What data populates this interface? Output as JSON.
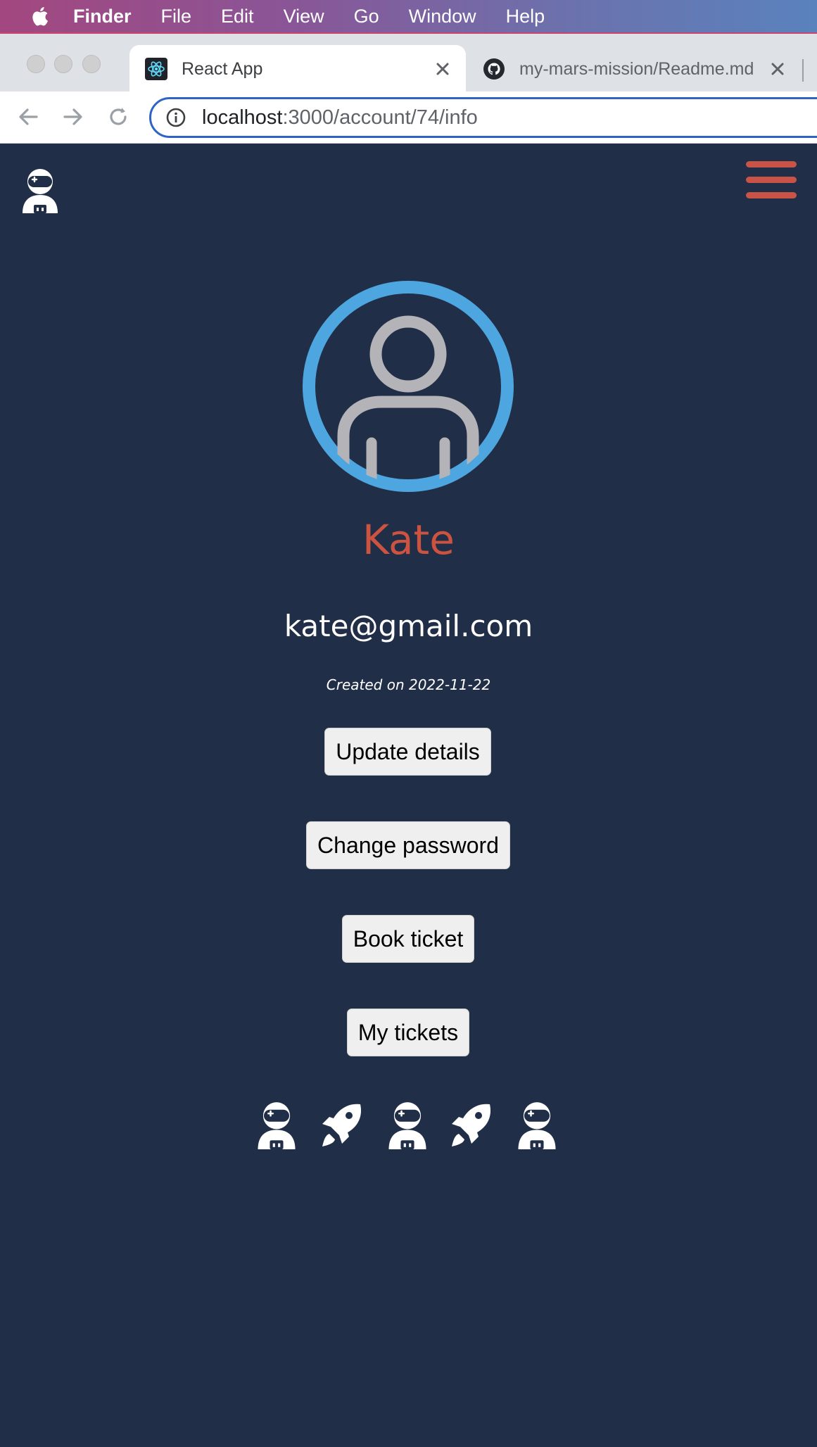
{
  "menubar": {
    "app_name": "Finder",
    "items": [
      "File",
      "Edit",
      "View",
      "Go",
      "Window",
      "Help"
    ]
  },
  "tabs": [
    {
      "title": "React App",
      "favicon": "react-icon",
      "active": true
    },
    {
      "title": "my-mars-mission/Readme.md",
      "favicon": "github-icon",
      "active": false
    }
  ],
  "address_bar": {
    "host": "localhost",
    "path": ":3000/account/74/info"
  },
  "profile": {
    "name": "Kate",
    "email": "kate@gmail.com",
    "created": "Created on 2022-11-22"
  },
  "buttons": {
    "update": "Update details",
    "password": "Change password",
    "book": "Book ticket",
    "tickets": "My tickets"
  },
  "decor_icons": [
    "astronaut-icon",
    "rocket-icon",
    "astronaut-icon",
    "rocket-icon",
    "astronaut-icon"
  ],
  "colors": {
    "page_bg": "#212e47",
    "name": "#cc5340",
    "menu_icon": "#c85346",
    "avatar_ring": "#4da6e0",
    "avatar_figure": "#b4b4b8"
  }
}
